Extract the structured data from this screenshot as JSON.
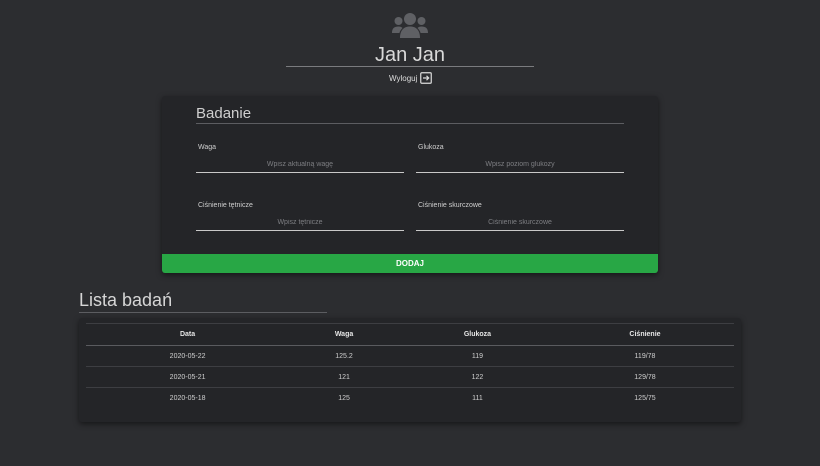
{
  "profile": {
    "icon": "users-icon",
    "name": "Jan Jan",
    "logout_label": "Wyloguj",
    "logout_icon": "logout-icon"
  },
  "exam_form": {
    "title": "Badanie",
    "fields": [
      {
        "label": "Waga",
        "placeholder": "Wpisz aktualną wagę",
        "value": ""
      },
      {
        "label": "Glukoza",
        "placeholder": "Wpisz poziom glukozy",
        "value": ""
      },
      {
        "label": "Ciśnienie tętnicze",
        "placeholder": "Wpisz tętnicze",
        "value": ""
      },
      {
        "label": "Ciśnienie skurczowe",
        "placeholder": "Ciśnienie skurczowe",
        "value": ""
      }
    ],
    "submit_label": "DODAJ"
  },
  "exam_list": {
    "title": "Lista badań",
    "columns": [
      "Data",
      "Waga",
      "Glukoza",
      "Ciśnienie"
    ],
    "rows": [
      [
        "2020-05-22",
        "125.2",
        "119",
        "119/78"
      ],
      [
        "2020-05-21",
        "121",
        "122",
        "129/78"
      ],
      [
        "2020-05-18",
        "125",
        "111",
        "125/75"
      ]
    ]
  },
  "colors": {
    "background": "#2c2d30",
    "card": "#242528",
    "accent_green": "#28a745"
  }
}
